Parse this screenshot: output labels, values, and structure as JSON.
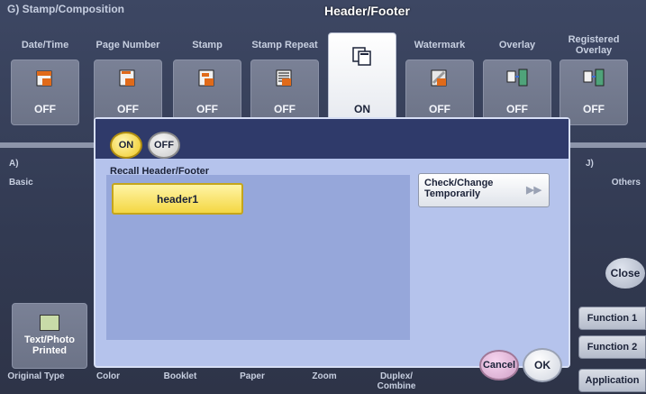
{
  "header": {
    "title": "G)  Stamp/Composition"
  },
  "tabs": [
    {
      "label": "Date/Time",
      "value": "OFF"
    },
    {
      "label": "Page Number",
      "value": "OFF"
    },
    {
      "label": "Stamp",
      "value": "OFF"
    },
    {
      "label": "Stamp Repeat",
      "value": "OFF"
    },
    {
      "label": "Header/Footer",
      "value": "ON"
    },
    {
      "label": "Watermark",
      "value": "OFF"
    },
    {
      "label": "Overlay",
      "value": "OFF"
    },
    {
      "label": "Registered Overlay",
      "value": "OFF"
    }
  ],
  "side": {
    "left_title": "A)",
    "left_sub": "Basic",
    "right_title": "J)",
    "right_sub": "Others"
  },
  "close_label": "Close",
  "function_buttons": [
    "Function 1",
    "Function 2",
    "Application"
  ],
  "original_button": {
    "label": "Text/Photo\nPrinted"
  },
  "bottom_tabs": [
    "Original Type",
    "Color",
    "Booklet",
    "Paper",
    "Zoom",
    "Duplex/\nCombine",
    "",
    ""
  ],
  "dialog": {
    "on_label": "ON",
    "off_label": "OFF",
    "recall_label": "Recall Header/Footer",
    "items": [
      "header1"
    ],
    "check_change_label": "Check/Change\nTemporarily",
    "cancel_label": "Cancel",
    "ok_label": "OK"
  },
  "colors": {
    "accent_yellow": "#f4d743",
    "dialog_bg": "#b5c3ec",
    "dialog_top": "#2f3a6a",
    "background": "#323a52"
  }
}
